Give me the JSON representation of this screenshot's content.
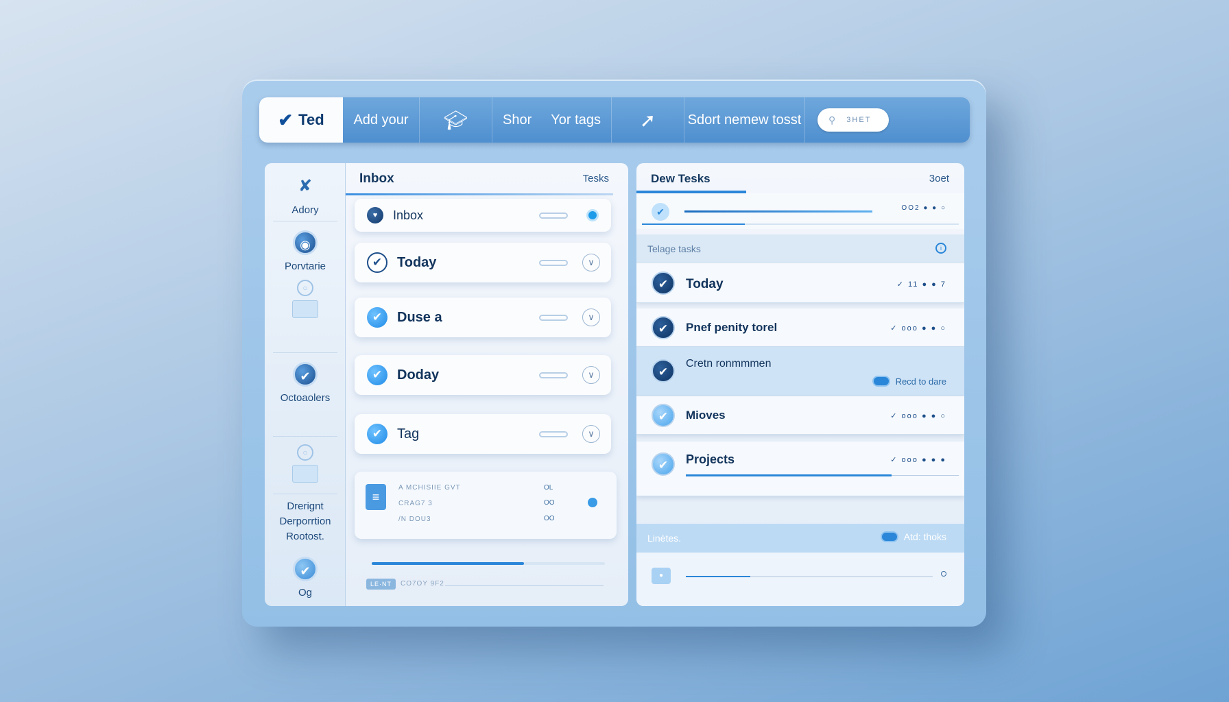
{
  "topbar": {
    "brand": "Ted",
    "items": [
      "Add your",
      "Shor",
      "Yor tags",
      "Sdort nemew tosst"
    ],
    "search_placeholder": "3HET"
  },
  "sidebar": {
    "items": [
      "Adory",
      "Porvtarie",
      "Octoaolers",
      "Drerignt Derporrtion Rootost.",
      "Og"
    ]
  },
  "middle": {
    "title": "Inbox",
    "subtitle": "Tesks",
    "tasks": [
      "Inbox",
      "Today",
      "Duse a",
      "Doday",
      "Tag"
    ],
    "note": {
      "line1": "A MCHISIIE GVT",
      "line2": "CRAG7 3",
      "line3": "/N DOU3",
      "right1": "OL",
      "right2": "OO",
      "right3": "OO"
    },
    "footer_tag": "LE·NT",
    "footer_text": "CO7OY 9F2"
  },
  "right": {
    "title": "Dew Tesks",
    "subtitle": "3oet",
    "first_meta": "OO2 ● ● ○",
    "section1": "Telage tasks",
    "tasks": [
      {
        "label": "Today",
        "meta": "✓    11 ● ● 7"
      },
      {
        "label": "Pnef penity torel",
        "meta": "✓    ooo ● ● ○"
      },
      {
        "label": "Cretn ronmmmen",
        "action": "Recd to dare"
      },
      {
        "label": "Mioves",
        "meta": "✓    ooo ● ● ○"
      },
      {
        "label": "Projects",
        "meta": "✓    ooo ● ● ●"
      }
    ],
    "section2": "Linètes.",
    "section2_action": "Atd: thoks"
  }
}
